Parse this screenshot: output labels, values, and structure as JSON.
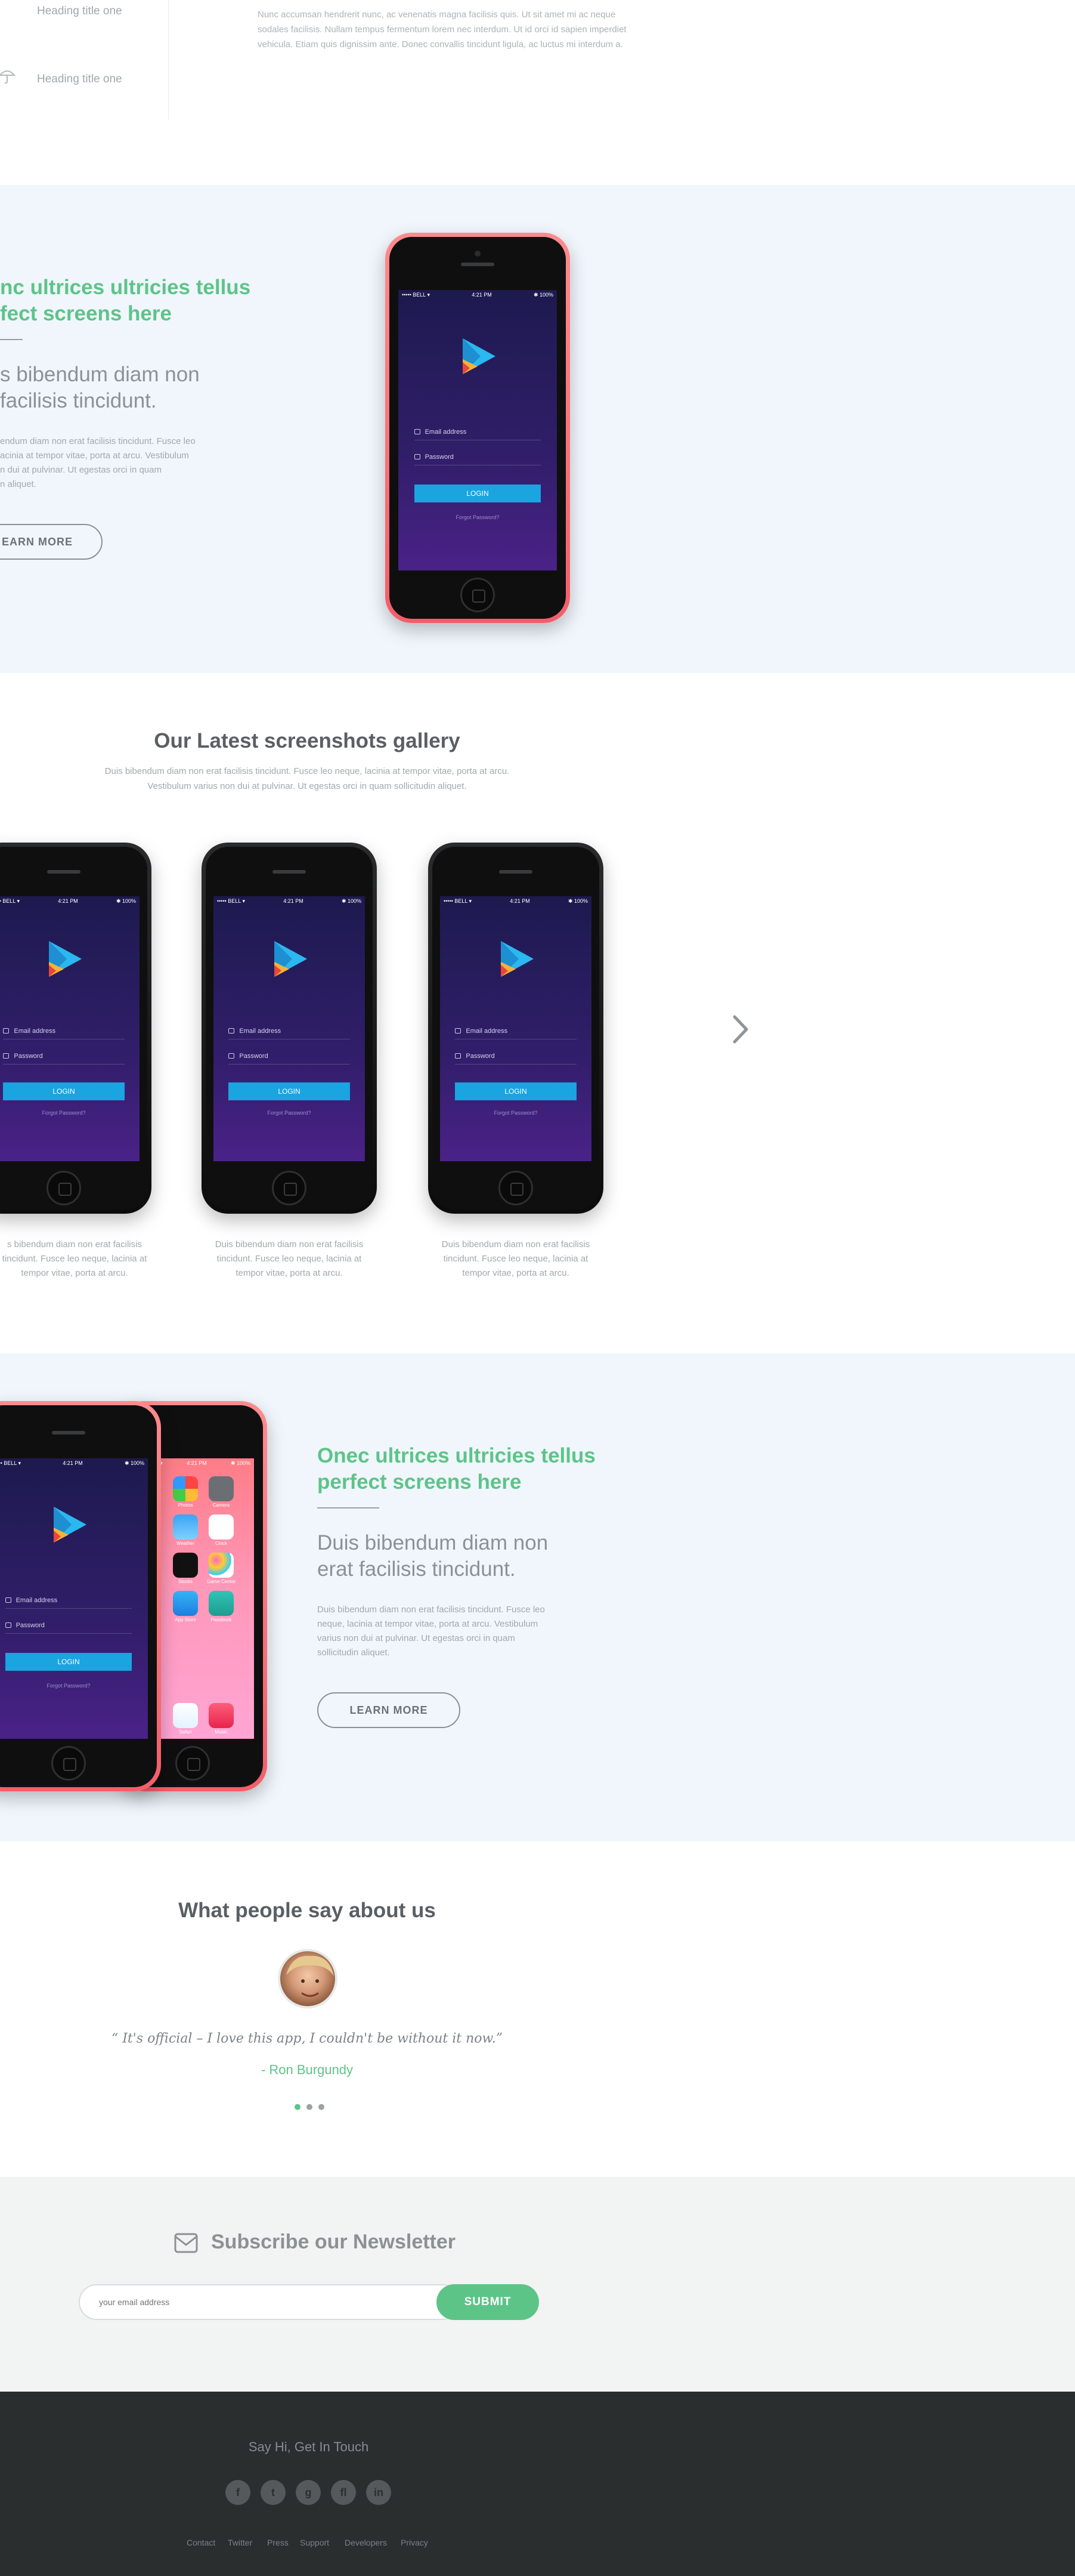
{
  "features": {
    "tab1": "Heading title one",
    "tab2": "Heading title one",
    "text": "Nunc accumsan hendrerit nunc, ac venenatis magna facilisis quis. Ut sit amet mi ac neque sodales facilisis. Nullam tempus fermentum lorem nec interdum. Ut id orci id sapien imperdiet vehicula. Etiam quis dignissim ante. Donec convallis tincidunt ligula, ac luctus mi interdum a."
  },
  "hero1": {
    "heading_line1": "nc ultrices ultricies tellus",
    "heading_line2": "fect screens here",
    "sub_line1": "s bibendum diam non",
    "sub_line2": "facilisis tincidunt.",
    "body": "endum diam non erat facilisis tincidunt. Fusce leo\nacinia at tempor vitae, porta at arcu. Vestibulum\nn dui at pulvinar. Ut egestas orci in quam\nn aliquet.",
    "button": "EARN MORE"
  },
  "phone": {
    "carrier": "••••• BELL ▾",
    "time": "4:21 PM",
    "battery": "✱ 100%",
    "email_placeholder": "Email address",
    "password_placeholder": "Password",
    "login": "LOGIN",
    "forgot": "Forgot Password?"
  },
  "gallery": {
    "title": "Our Latest screenshots gallery",
    "description": "Duis bibendum diam non erat facilisis tincidunt. Fusce leo neque, lacinia at tempor vitae, porta at arcu. Vestibulum varius non dui at pulvinar. Ut egestas orci in quam sollicitudin aliquet.",
    "captions": [
      "s bibendum diam non erat facilisis\ntincidunt. Fusce leo neque, lacinia at\ntempor vitae, porta at arcu.",
      "Duis bibendum diam non erat facilisis\ntincidunt. Fusce leo neque, lacinia at\ntempor vitae, porta at arcu.",
      "Duis bibendum diam non erat facilisis\ntincidunt. Fusce leo neque, lacinia at\ntempor vitae, porta at arcu."
    ]
  },
  "hero2": {
    "heading_line1": "Onec ultrices ultricies tellus",
    "heading_line2": "perfect screens here",
    "sub_line1": "Duis bibendum diam non",
    "sub_line2": "erat facilisis tincidunt.",
    "body": "Duis bibendum diam non erat facilisis tincidunt. Fusce leo\nneque, lacinia at tempor vitae, porta at arcu. Vestibulum\nvarius non dui at pulvinar. Ut egestas orci in quam\nsollicitudin aliquet.",
    "button": "LEARN MORE",
    "ios_apps": [
      "Photos",
      "Camera",
      "Weather",
      "Clock",
      "Stocks",
      "Game Center",
      "App Store",
      "Passbook",
      "Safari",
      "Music"
    ]
  },
  "testimonials": {
    "title": "What people say about us",
    "quote": "“ It's official – I love this app, I couldn't be without it now.”",
    "author": "- Ron Burgundy"
  },
  "newsletter": {
    "title": "Subscribe our Newsletter",
    "placeholder": "your email address",
    "button": "SUBMIT"
  },
  "footer": {
    "tagline": "Say Hi, Get In Touch",
    "social": [
      "f",
      "t",
      "g",
      "fl",
      "in"
    ],
    "links": [
      "Contact",
      "Twitter",
      "Press",
      "Support",
      "Developers",
      "Privacy"
    ]
  },
  "colors": {
    "accent_green": "#5dc488",
    "section_blue": "#f0f6fc",
    "login_blue": "#1aa4e0",
    "footer_dark": "#2b2e2f",
    "pink_phone": "#f35e69"
  }
}
